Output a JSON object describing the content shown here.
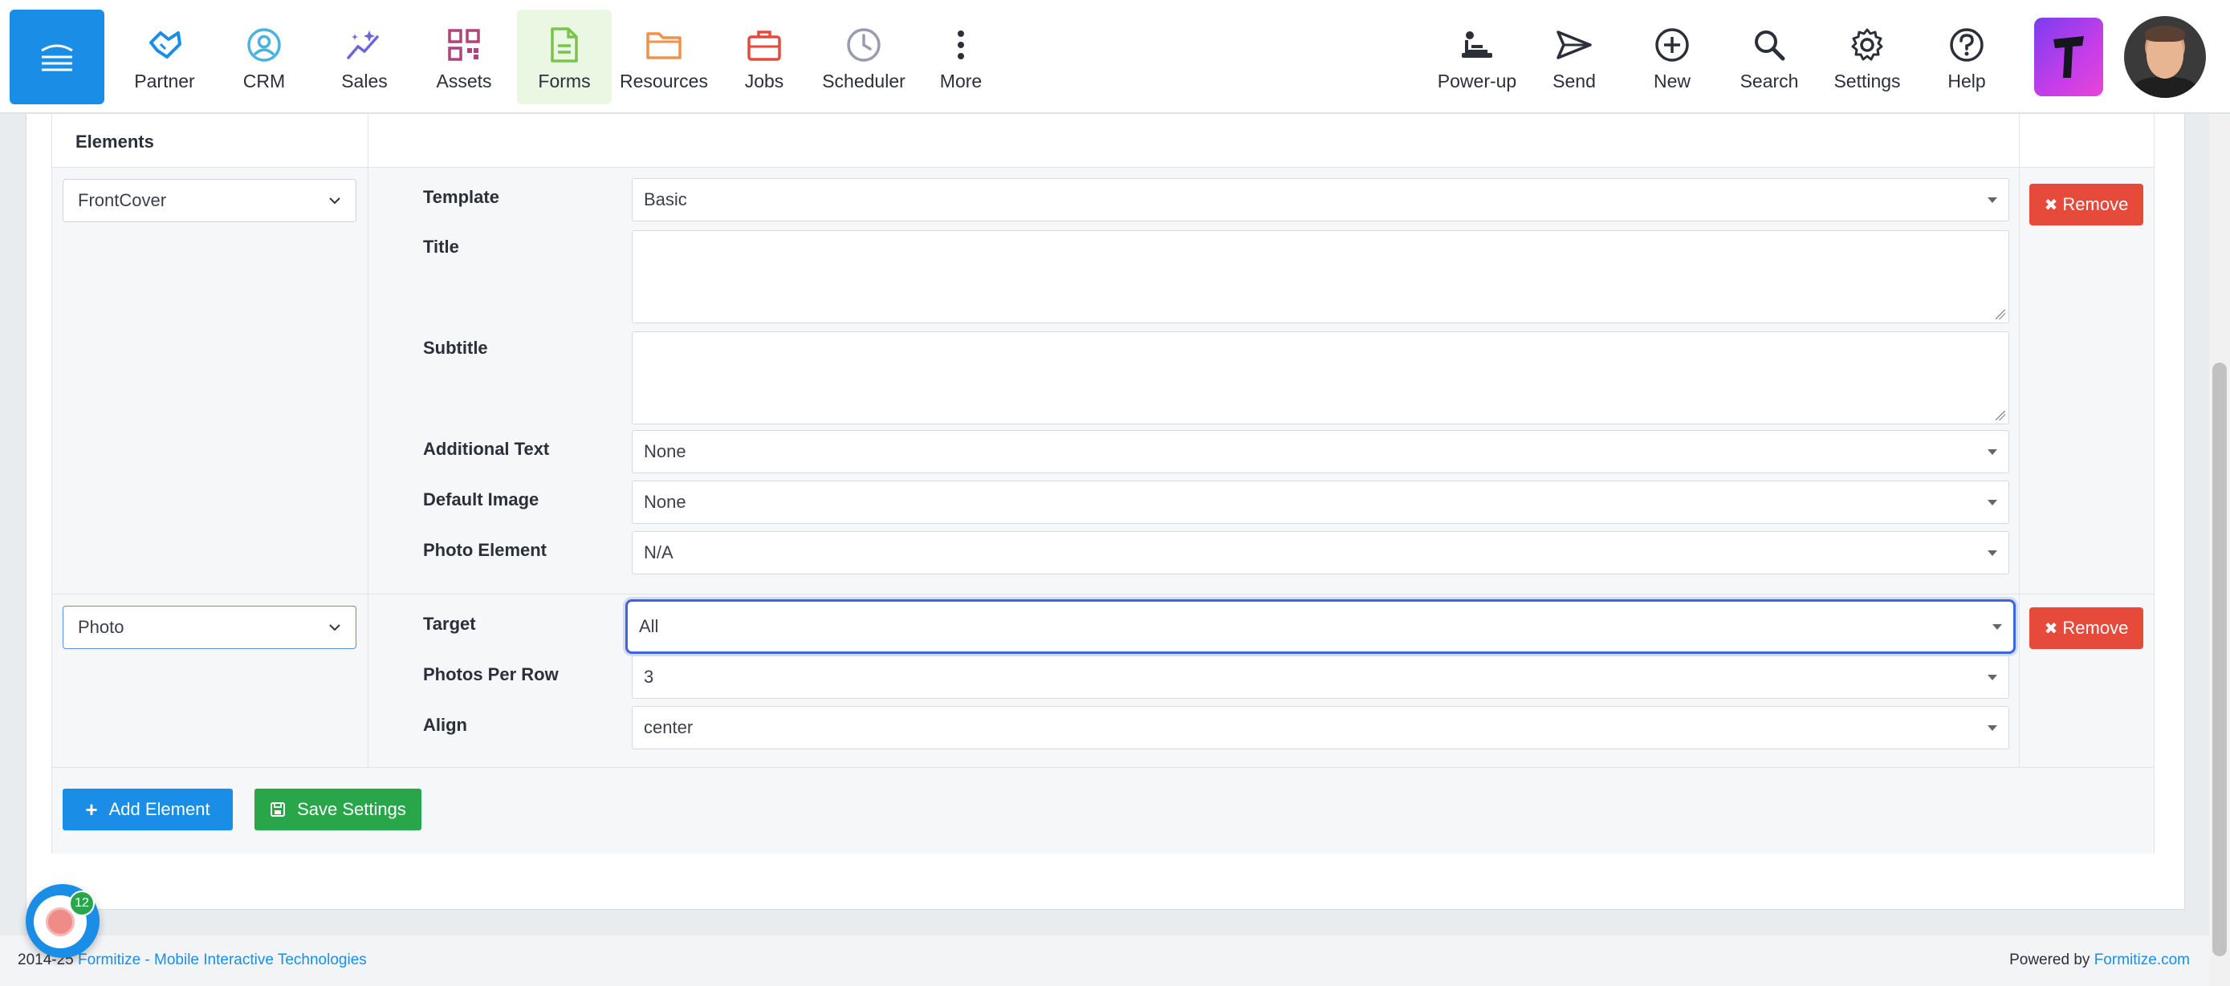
{
  "nav": {
    "items": [
      {
        "label": "Partner",
        "icon": "handshake-icon"
      },
      {
        "label": "CRM",
        "icon": "user-circle-icon"
      },
      {
        "label": "Sales",
        "icon": "sparkle-chart-icon"
      },
      {
        "label": "Assets",
        "icon": "qr-grid-icon"
      },
      {
        "label": "Forms",
        "icon": "document-icon"
      },
      {
        "label": "Resources",
        "icon": "folder-icon"
      },
      {
        "label": "Jobs",
        "icon": "briefcase-icon"
      },
      {
        "label": "Scheduler",
        "icon": "clock-icon"
      },
      {
        "label": "More",
        "icon": "kebab-icon"
      }
    ],
    "right_items": [
      {
        "label": "Power-up",
        "icon": "power-up-icon"
      },
      {
        "label": "Send",
        "icon": "send-icon"
      },
      {
        "label": "New",
        "icon": "plus-circle-icon"
      },
      {
        "label": "Search",
        "icon": "search-icon"
      },
      {
        "label": "Settings",
        "icon": "gear-icon"
      },
      {
        "label": "Help",
        "icon": "help-icon"
      }
    ],
    "accent": "#1a8ee6",
    "active_bg": "#e9f7e3"
  },
  "elements": {
    "header": "Elements",
    "rows": [
      {
        "type": "FrontCover",
        "fields": {
          "template": {
            "label": "Template",
            "value": "Basic"
          },
          "title": {
            "label": "Title",
            "value": ""
          },
          "subtitle": {
            "label": "Subtitle",
            "value": ""
          },
          "additional_text": {
            "label": "Additional Text",
            "value": "None"
          },
          "default_image": {
            "label": "Default Image",
            "value": "None"
          },
          "photo_element": {
            "label": "Photo Element",
            "value": "N/A"
          }
        },
        "remove_label": "Remove"
      },
      {
        "type": "Photo",
        "fields": {
          "target": {
            "label": "Target",
            "value": "All"
          },
          "photos_per_row": {
            "label": "Photos Per Row",
            "value": "3"
          },
          "align": {
            "label": "Align",
            "value": "center"
          }
        },
        "remove_label": "Remove"
      }
    ],
    "add_label": "Add Element",
    "save_label": "Save Settings"
  },
  "footer": {
    "years": "2014-25",
    "company": "Formitize - Mobile Interactive Technologies",
    "powered_prefix": "Powered by",
    "powered_link": "Formitize.com"
  },
  "recorder": {
    "badge": "12"
  },
  "colors": {
    "remove": "#e64a3b",
    "save": "#2aa64a",
    "primary": "#1a8ee6",
    "focus": "#3b66e0"
  }
}
